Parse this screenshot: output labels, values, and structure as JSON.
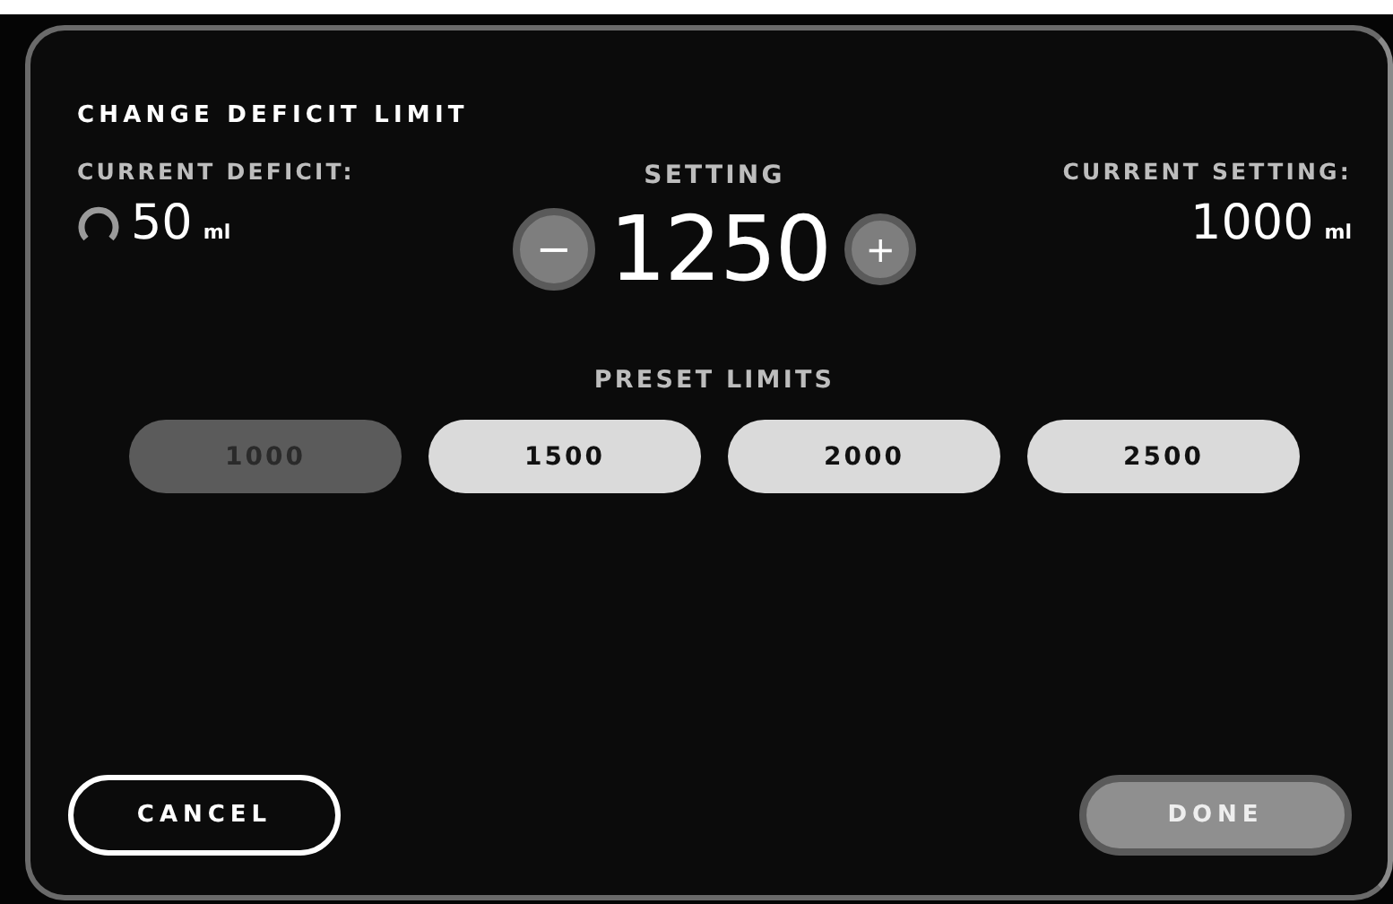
{
  "dialog": {
    "title": "CHANGE DEFICIT LIMIT",
    "current_deficit": {
      "label": "CURRENT DEFICIT:",
      "value": "50",
      "unit": "ml"
    },
    "current_setting": {
      "label": "CURRENT SETTING:",
      "value": "1000",
      "unit": "ml"
    },
    "setting": {
      "label": "SETTING",
      "value": "1250",
      "decrease": "−",
      "increase": "+"
    },
    "presets": {
      "label": "PRESET LIMITS",
      "items": [
        {
          "label": "1000",
          "disabled": true
        },
        {
          "label": "1500",
          "disabled": false
        },
        {
          "label": "2000",
          "disabled": false
        },
        {
          "label": "2500",
          "disabled": false
        }
      ]
    },
    "buttons": {
      "cancel": "CANCEL",
      "done": "DONE"
    }
  }
}
